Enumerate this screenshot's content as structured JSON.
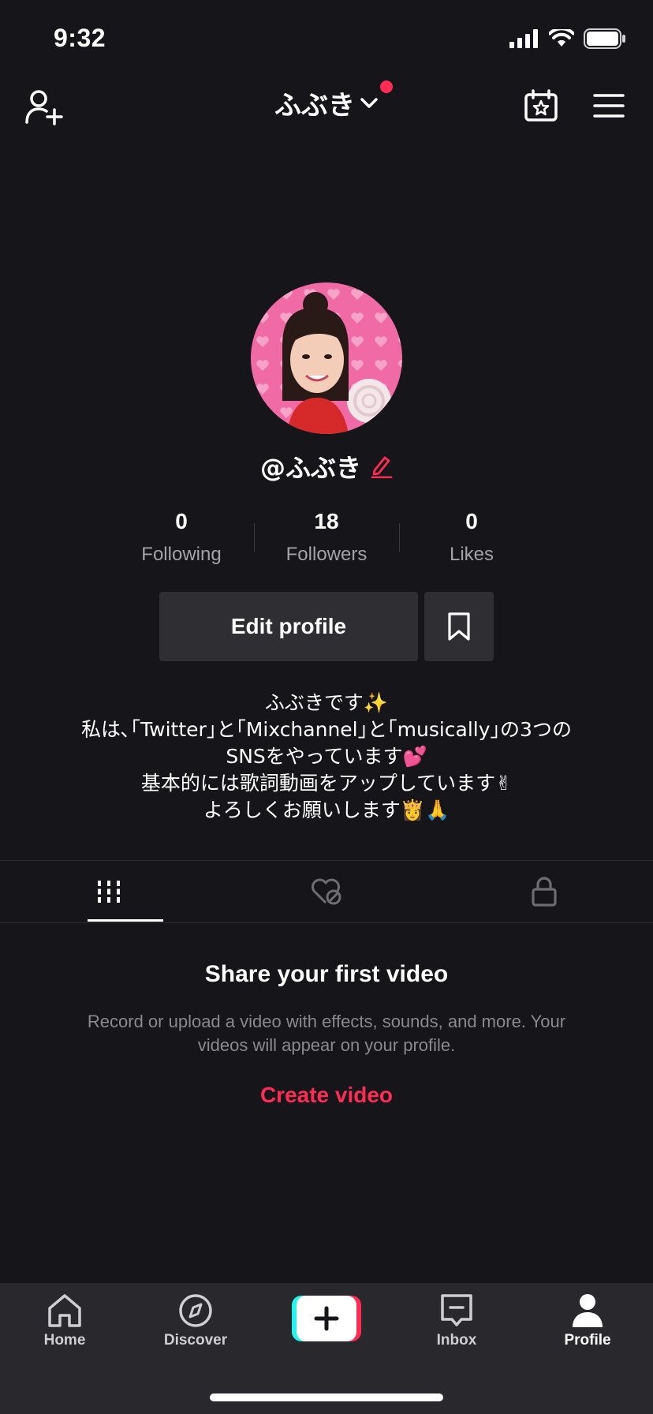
{
  "status_bar": {
    "time": "9:32"
  },
  "header": {
    "title": "ふぶき"
  },
  "profile": {
    "handle": "@ふぶき",
    "stats": [
      {
        "count": "0",
        "label": "Following"
      },
      {
        "count": "18",
        "label": "Followers"
      },
      {
        "count": "0",
        "label": "Likes"
      }
    ],
    "edit_label": "Edit profile",
    "bio": [
      "ふぶきです✨",
      "私は､｢Twitter｣と｢Mixchannel｣と｢musically｣の3つの",
      "SNSをやっています💕",
      "基本的には歌詞動画をアップしています✌",
      "よろしくお願いします👸🙏"
    ]
  },
  "tabs": [
    {
      "icon": "grid-icon",
      "active": true
    },
    {
      "icon": "liked-hidden-icon",
      "active": false
    },
    {
      "icon": "lock-icon",
      "active": false
    }
  ],
  "empty_state": {
    "title": "Share your first video",
    "description": "Record or upload a video with effects, sounds, and more. Your videos will appear on your profile.",
    "action": "Create video"
  },
  "bottom_nav": {
    "items": [
      {
        "label": "Home",
        "icon": "home-icon"
      },
      {
        "label": "Discover",
        "icon": "compass-icon"
      },
      {
        "label": "Inbox",
        "icon": "inbox-icon"
      },
      {
        "label": "Profile",
        "icon": "person-icon",
        "active": true
      }
    ]
  },
  "colors": {
    "accent": "#fe2c55",
    "background": "#161519",
    "surface": "#2f2e33"
  }
}
